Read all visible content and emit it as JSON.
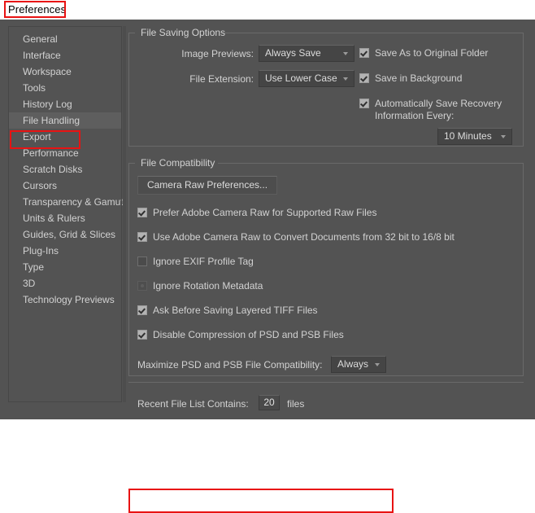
{
  "window": {
    "title": "Preferences"
  },
  "sidebar": {
    "items": [
      {
        "label": "General",
        "selected": false
      },
      {
        "label": "Interface",
        "selected": false
      },
      {
        "label": "Workspace",
        "selected": false
      },
      {
        "label": "Tools",
        "selected": false
      },
      {
        "label": "History Log",
        "selected": false
      },
      {
        "label": "File Handling",
        "selected": true
      },
      {
        "label": "Export",
        "selected": false
      },
      {
        "label": "Performance",
        "selected": false
      },
      {
        "label": "Scratch Disks",
        "selected": false
      },
      {
        "label": "Cursors",
        "selected": false
      },
      {
        "label": "Transparency & Gamut",
        "selected": false
      },
      {
        "label": "Units & Rulers",
        "selected": false
      },
      {
        "label": "Guides, Grid & Slices",
        "selected": false
      },
      {
        "label": "Plug-Ins",
        "selected": false
      },
      {
        "label": "Type",
        "selected": false
      },
      {
        "label": "3D",
        "selected": false
      },
      {
        "label": "Technology Previews",
        "selected": false
      }
    ]
  },
  "file_saving_options": {
    "legend": "File Saving Options",
    "image_previews_label": "Image Previews:",
    "image_previews_value": "Always Save",
    "file_extension_label": "File Extension:",
    "file_extension_value": "Use Lower Case",
    "save_as_original_folder": {
      "label": "Save As to Original Folder",
      "checked": true
    },
    "save_in_background": {
      "label": "Save in Background",
      "checked": true
    },
    "auto_save_recovery": {
      "label": "Automatically Save Recovery Information Every:",
      "checked": true
    },
    "auto_save_interval_value": "10 Minutes"
  },
  "file_compatibility": {
    "legend": "File Compatibility",
    "camera_raw_button": "Camera Raw Preferences...",
    "checkboxes": [
      {
        "label": "Prefer Adobe Camera Raw for Supported Raw Files",
        "state": "on"
      },
      {
        "label": "Use Adobe Camera Raw to Convert Documents from 32 bit to 16/8 bit",
        "state": "on"
      },
      {
        "label": "Ignore EXIF Profile Tag",
        "state": "off"
      },
      {
        "label": "Ignore Rotation Metadata",
        "state": "dim"
      },
      {
        "label": "Ask Before Saving Layered TIFF Files",
        "state": "on"
      },
      {
        "label": "Disable Compression of PSD and PSB Files",
        "state": "on"
      }
    ],
    "maximize_label": "Maximize PSD and PSB File Compatibility:",
    "maximize_value": "Always"
  },
  "recent_files": {
    "label": "Recent File List Contains:",
    "value": "20",
    "suffix": "files"
  },
  "colors": {
    "dialog_background": "#535353",
    "text": "#d2d2d2",
    "annotation_red": "#e81313",
    "selected_row": "#5e5e5e"
  }
}
